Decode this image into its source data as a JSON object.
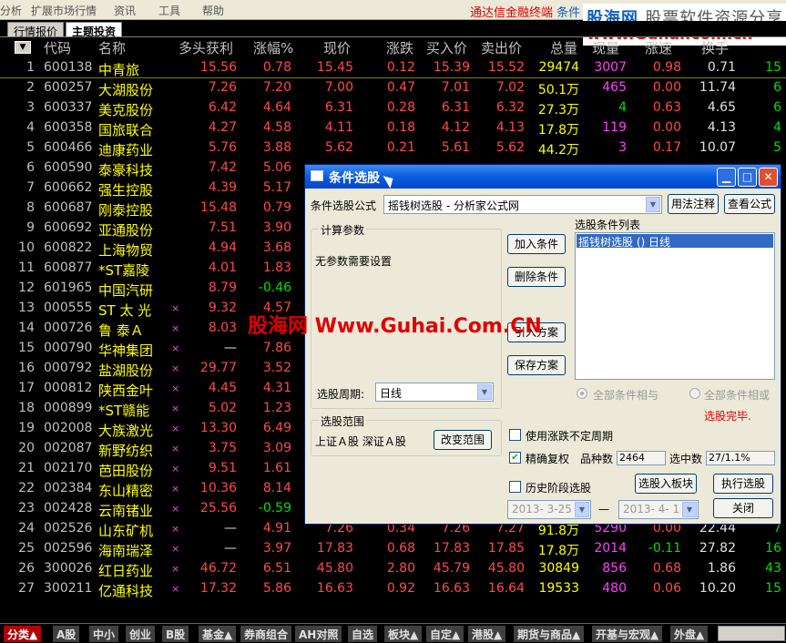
{
  "menu": {
    "items": [
      "分析",
      "扩展市场行情",
      "资讯",
      "工具",
      "帮助"
    ],
    "promo": "通达信金融终端",
    "promo_tail": "条件"
  },
  "watermark": {
    "site_cn": "股海网",
    "slogan": "股票软件资源分享",
    "url": "www.Guhai.com.cn",
    "mid_text": "股海网 Www.Guhai.Com.CN"
  },
  "tabs": [
    {
      "label": "行情报价"
    },
    {
      "label": "主题投资"
    }
  ],
  "table": {
    "sort_icon": "▼",
    "columns": [
      "代码",
      "名称",
      "多头获利",
      "涨幅%",
      "现价",
      "涨跌",
      "买入价",
      "卖出价",
      "总量",
      "现量",
      "涨速",
      "换手"
    ],
    "rows": [
      {
        "n": "1",
        "code": "600138",
        "name": "中青旅",
        "mark": "",
        "v1": "15.56",
        "v2": "0.78",
        "v3": "15.45",
        "v4": "0.12",
        "v5": "15.39",
        "v6": "15.52",
        "v7": "29474",
        "v8": "3007",
        "v9": "0.98",
        "v10": "0.71",
        "v11": "15"
      },
      {
        "n": "2",
        "code": "600257",
        "name": "大湖股份",
        "mark": "",
        "v1": "7.26",
        "v2": "7.20",
        "v3": "7.00",
        "v4": "0.47",
        "v5": "7.01",
        "v6": "7.02",
        "v7": "50.1万",
        "v8": "465",
        "v9": "0.00",
        "v10": "11.74",
        "v11": "6"
      },
      {
        "n": "3",
        "code": "600337",
        "name": "美克股份",
        "mark": "",
        "v1": "6.42",
        "v2": "4.64",
        "v3": "6.31",
        "v4": "0.28",
        "v5": "6.31",
        "v6": "6.32",
        "v7": "27.3万",
        "v8": "4",
        "v9": "0.63",
        "v10": "4.65",
        "v11": "6"
      },
      {
        "n": "4",
        "code": "600358",
        "name": "国旅联合",
        "mark": "",
        "v1": "4.27",
        "v2": "4.58",
        "v3": "4.11",
        "v4": "0.18",
        "v5": "4.12",
        "v6": "4.13",
        "v7": "17.8万",
        "v8": "119",
        "v9": "0.00",
        "v10": "4.13",
        "v11": "4"
      },
      {
        "n": "5",
        "code": "600466",
        "name": "迪康药业",
        "mark": "",
        "v1": "5.76",
        "v2": "3.88",
        "v3": "5.62",
        "v4": "0.21",
        "v5": "5.61",
        "v6": "5.62",
        "v7": "44.2万",
        "v8": "3",
        "v9": "0.17",
        "v10": "10.07",
        "v11": "5"
      },
      {
        "n": "6",
        "code": "600590",
        "name": "泰豪科技",
        "mark": "",
        "v1": "7.42",
        "v2": "5.06",
        "v3": "",
        "v4": "",
        "v5": "",
        "v6": "",
        "v7": "",
        "v8": "",
        "v9": "",
        "v10": "",
        "v11": ""
      },
      {
        "n": "7",
        "code": "600662",
        "name": "强生控股",
        "mark": "",
        "v1": "4.39",
        "v2": "5.17",
        "v3": "",
        "v4": "",
        "v5": "",
        "v6": "",
        "v7": "",
        "v8": "",
        "v9": "",
        "v10": "",
        "v11": ""
      },
      {
        "n": "8",
        "code": "600687",
        "name": "刚泰控股",
        "mark": "",
        "v1": "15.48",
        "v2": "0.79",
        "v3": "",
        "v4": "",
        "v5": "",
        "v6": "",
        "v7": "",
        "v8": "",
        "v9": "",
        "v10": "",
        "v11": ""
      },
      {
        "n": "9",
        "code": "600692",
        "name": "亚通股份",
        "mark": "",
        "v1": "7.51",
        "v2": "3.90",
        "v3": "",
        "v4": "",
        "v5": "",
        "v6": "",
        "v7": "",
        "v8": "",
        "v9": "",
        "v10": "",
        "v11": ""
      },
      {
        "n": "10",
        "code": "600822",
        "name": "上海物贸",
        "mark": "",
        "v1": "4.94",
        "v2": "3.68",
        "v3": "",
        "v4": "",
        "v5": "",
        "v6": "",
        "v7": "",
        "v8": "",
        "v9": "",
        "v10": "",
        "v11": ""
      },
      {
        "n": "11",
        "code": "600877",
        "name": "*ST嘉陵",
        "mark": "",
        "v1": "4.01",
        "v2": "1.83",
        "v3": "",
        "v4": "",
        "v5": "",
        "v6": "",
        "v7": "",
        "v8": "",
        "v9": "",
        "v10": "",
        "v11": ""
      },
      {
        "n": "12",
        "code": "601965",
        "name": "中国汽研",
        "mark": "",
        "v1": "8.79",
        "v2": "-0.46",
        "v3": "",
        "v4": "",
        "v5": "",
        "v6": "",
        "v7": "",
        "v8": "",
        "v9": "",
        "v10": "",
        "v11": ""
      },
      {
        "n": "13",
        "code": "000555",
        "name": "ST 太 光",
        "mark": "×",
        "v1": "9.32",
        "v2": "4.57",
        "v3": "",
        "v4": "",
        "v5": "",
        "v6": "",
        "v7": "",
        "v8": "",
        "v9": "",
        "v10": "",
        "v11": ""
      },
      {
        "n": "14",
        "code": "000726",
        "name": "鲁  泰Ａ",
        "mark": "×",
        "v1": "8.03",
        "v2": "",
        "v3": "",
        "v4": "",
        "v5": "",
        "v6": "",
        "v7": "",
        "v8": "",
        "v9": "",
        "v10": "",
        "v11": ""
      },
      {
        "n": "15",
        "code": "000790",
        "name": "华神集团",
        "mark": "×",
        "v1": "—",
        "v2": "7.86",
        "v3": "",
        "v4": "",
        "v5": "",
        "v6": "",
        "v7": "",
        "v8": "",
        "v9": "",
        "v10": "",
        "v11": ""
      },
      {
        "n": "16",
        "code": "000792",
        "name": "盐湖股份",
        "mark": "×",
        "v1": "29.77",
        "v2": "3.52",
        "v3": "",
        "v4": "",
        "v5": "",
        "v6": "",
        "v7": "",
        "v8": "",
        "v9": "",
        "v10": "",
        "v11": ""
      },
      {
        "n": "17",
        "code": "000812",
        "name": "陕西金叶",
        "mark": "×",
        "v1": "4.45",
        "v2": "4.31",
        "v3": "",
        "v4": "",
        "v5": "",
        "v6": "",
        "v7": "",
        "v8": "",
        "v9": "",
        "v10": "",
        "v11": ""
      },
      {
        "n": "18",
        "code": "000899",
        "name": "*ST赣能",
        "mark": "×",
        "v1": "5.02",
        "v2": "1.23",
        "v3": "",
        "v4": "",
        "v5": "",
        "v6": "",
        "v7": "",
        "v8": "",
        "v9": "",
        "v10": "",
        "v11": ""
      },
      {
        "n": "19",
        "code": "002008",
        "name": "大族激光",
        "mark": "×",
        "v1": "13.30",
        "v2": "6.49",
        "v3": "",
        "v4": "",
        "v5": "",
        "v6": "",
        "v7": "",
        "v8": "",
        "v9": "",
        "v10": "",
        "v11": ""
      },
      {
        "n": "20",
        "code": "002087",
        "name": "新野纺织",
        "mark": "×",
        "v1": "3.75",
        "v2": "3.09",
        "v3": "",
        "v4": "",
        "v5": "",
        "v6": "",
        "v7": "",
        "v8": "",
        "v9": "",
        "v10": "",
        "v11": ""
      },
      {
        "n": "21",
        "code": "002170",
        "name": "芭田股份",
        "mark": "×",
        "v1": "9.51",
        "v2": "1.61",
        "v3": "",
        "v4": "",
        "v5": "",
        "v6": "",
        "v7": "",
        "v8": "",
        "v9": "",
        "v10": "",
        "v11": ""
      },
      {
        "n": "22",
        "code": "002384",
        "name": "东山精密",
        "mark": "×",
        "v1": "10.36",
        "v2": "8.14",
        "v3": "",
        "v4": "",
        "v5": "",
        "v6": "",
        "v7": "",
        "v8": "",
        "v9": "",
        "v10": "",
        "v11": ""
      },
      {
        "n": "23",
        "code": "002428",
        "name": "云南锗业",
        "mark": "×",
        "v1": "25.56",
        "v2": "-0.59",
        "v3": "",
        "v4": "",
        "v5": "",
        "v6": "",
        "v7": "",
        "v8": "",
        "v9": "",
        "v10": "",
        "v11": ""
      },
      {
        "n": "24",
        "code": "002526",
        "name": "山东矿机",
        "mark": "×",
        "v1": "—",
        "v2": "4.91",
        "v3": "7.26",
        "v4": "0.34",
        "v5": "7.26",
        "v6": "7.27",
        "v7": "91.8万",
        "v8": "5290",
        "v9": "0.00",
        "v10": "22.44",
        "v11": "7"
      },
      {
        "n": "25",
        "code": "002596",
        "name": "海南瑞泽",
        "mark": "×",
        "v1": "—",
        "v2": "3.97",
        "v3": "17.83",
        "v4": "0.68",
        "v5": "17.83",
        "v6": "17.85",
        "v7": "17.8万",
        "v8": "2014",
        "v9": "-0.11",
        "v10": "27.82",
        "v11": "16"
      },
      {
        "n": "26",
        "code": "300026",
        "name": "红日药业",
        "mark": "×",
        "v1": "46.72",
        "v2": "6.51",
        "v3": "45.80",
        "v4": "2.80",
        "v5": "45.79",
        "v6": "45.80",
        "v7": "30849",
        "v8": "856",
        "v9": "0.68",
        "v10": "1.86",
        "v11": "43"
      },
      {
        "n": "27",
        "code": "300211",
        "name": "亿通科技",
        "mark": "×",
        "v1": "17.32",
        "v2": "5.86",
        "v3": "16.63",
        "v4": "0.92",
        "v5": "16.63",
        "v6": "16.64",
        "v7": "19533",
        "v8": "480",
        "v9": "0.06",
        "v10": "10.20",
        "v11": "15"
      }
    ]
  },
  "bottom_tabs": [
    "分类▲",
    "A股",
    "中小",
    "创业",
    "B股",
    "基金▲",
    "券商组合",
    "AH对照",
    "自选",
    "板块▲",
    "自定▲",
    "港股▲",
    "期货与商品▲",
    "开基与宏观▲",
    "外盘▲"
  ],
  "dialog": {
    "title": "条件选股",
    "formula_label": "条件选股公式",
    "formula_value": "摇钱树选股 - 分析家公式网",
    "btn_usage": "用法注释",
    "btn_view": "查看公式",
    "calc_group": "计算参数",
    "no_params": "无参数需要设置",
    "btn_add": "加入条件",
    "btn_delete": "删除条件",
    "btn_import": "引入方案",
    "btn_save": "保存方案",
    "cond_list_label": "选股条件列表",
    "cond_item": "摇钱树选股 () 日线",
    "period_label": "选股周期:",
    "period_value": "日线",
    "radio_and": "全部条件相与",
    "radio_or": "全部条件相或",
    "status": "选股完毕.",
    "range_group": "选股范围",
    "range_value": "上证Ａ股 深证Ａ股",
    "btn_change_range": "改变范围",
    "chk_uncertain": "使用涨跌不定周期",
    "chk_exact": "精确复权",
    "count_label": "品种数",
    "count_value": "2464",
    "hit_label": "选中数",
    "hit_value": "27/1.1%",
    "chk_history": "历史阶段选股",
    "btn_to_block": "选股入板块",
    "btn_run": "执行选股",
    "date_from": "2013- 3-25",
    "date_sep": "—",
    "date_to": "2013- 4- 1",
    "btn_close": "关闭"
  }
}
